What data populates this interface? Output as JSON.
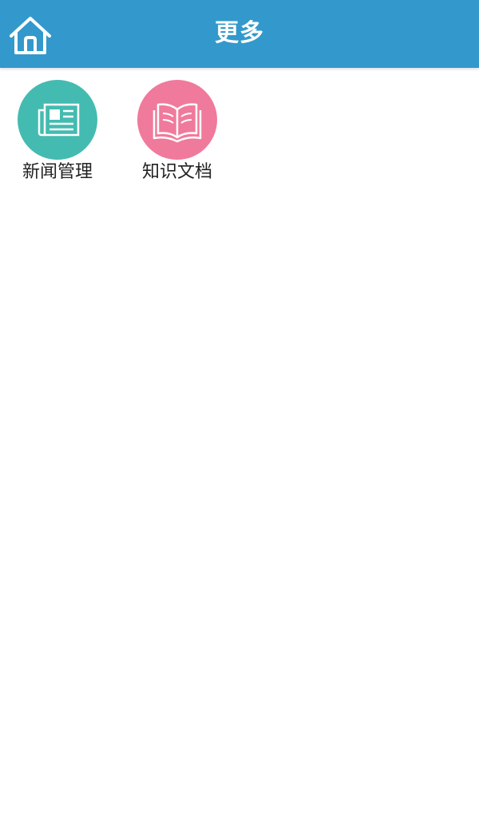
{
  "header": {
    "title": "更多",
    "home_icon": "home-icon",
    "background_color": "#3399cc"
  },
  "menu": {
    "items": [
      {
        "label": "新闻管理",
        "icon": "newspaper-icon",
        "color": "#44bbb0"
      },
      {
        "label": "知识文档",
        "icon": "book-icon",
        "color": "#f07a9c"
      }
    ]
  }
}
